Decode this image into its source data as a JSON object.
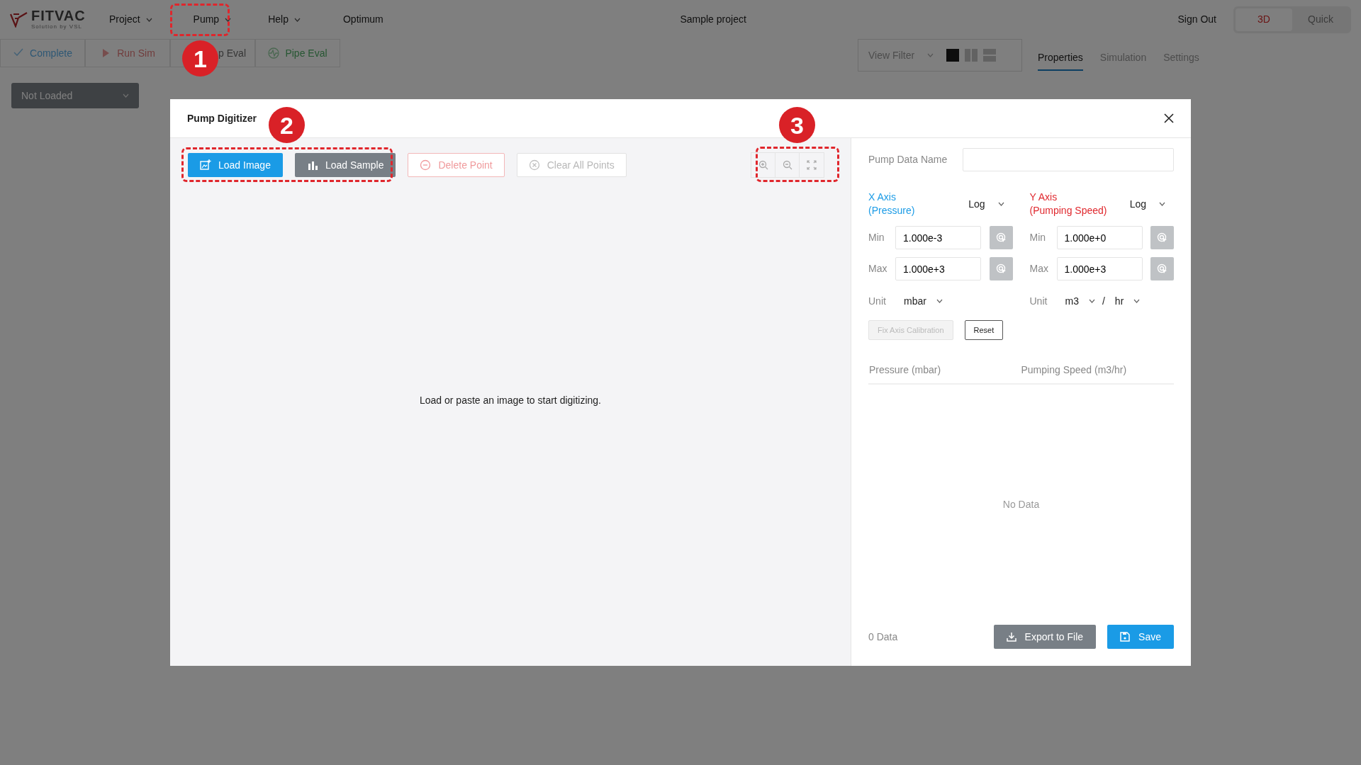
{
  "app": {
    "logo_text": "FITVAC",
    "logo_tagline": "Solution by VSL"
  },
  "menu": [
    {
      "label": "Project",
      "dropdown": true
    },
    {
      "label": "Pump",
      "dropdown": true
    },
    {
      "label": "Help",
      "dropdown": true
    },
    {
      "label": "Optimum",
      "dropdown": false
    }
  ],
  "project_title": "Sample project",
  "sign_out": "Sign Out",
  "mode_toggle": [
    {
      "label": "3D",
      "selected": true
    },
    {
      "label": "Quick",
      "selected": false
    }
  ],
  "toolbar": [
    {
      "label": "Complete",
      "kind": "check"
    },
    {
      "label": "Run Sim",
      "kind": "play"
    },
    {
      "label": "p Eval",
      "kind": "plain"
    },
    {
      "label": "Pipe Eval",
      "kind": "pulse"
    }
  ],
  "view_filter": {
    "label": "View Filter"
  },
  "layouts": [
    {
      "kind": "single",
      "selected": true
    },
    {
      "kind": "columns",
      "selected": false
    },
    {
      "kind": "rows",
      "selected": false
    }
  ],
  "panel_tabs": [
    {
      "label": "Properties",
      "selected": true
    },
    {
      "label": "Simulation",
      "selected": false
    },
    {
      "label": "Settings",
      "selected": false
    }
  ],
  "model_select": {
    "value": "Not Loaded"
  },
  "modal": {
    "title": "Pump Digitizer",
    "actions": [
      {
        "label": "Load Image",
        "kind": "primary"
      },
      {
        "label": "Load Sample",
        "kind": "secondary"
      },
      {
        "label": "Delete Point",
        "kind": "danger"
      },
      {
        "label": "Clear All Points",
        "kind": "disabled"
      }
    ],
    "zoom_tools": [
      {
        "kind": "zoom-in"
      },
      {
        "kind": "zoom-out"
      },
      {
        "kind": "fit"
      }
    ],
    "canvas_message": "Load or paste an image to start digitizing.",
    "name_label": "Pump Data Name",
    "axes": [
      {
        "title": "X Axis",
        "subtitle": "(Pressure)",
        "color": "#1a9be6",
        "scale": "Log",
        "min_label": "Min",
        "min": "1.000e-3",
        "max_label": "Max",
        "max": "1.000e+3",
        "unit_label": "Unit",
        "units": [
          "mbar"
        ]
      },
      {
        "title": "Y Axis",
        "subtitle": "(Pumping Speed)",
        "color": "#e0282e",
        "scale": "Log",
        "min_label": "Min",
        "min": "1.000e+0",
        "max_label": "Max",
        "max": "1.000e+3",
        "unit_label": "Unit",
        "units": [
          "m3",
          "hr"
        ],
        "unit_separator": "/"
      }
    ],
    "calibration_buttons": [
      {
        "label": "Fix Axis Calibration",
        "disabled": true
      },
      {
        "label": "Reset",
        "disabled": false
      }
    ],
    "table": {
      "columns": [
        "Pressure (mbar)",
        "Pumping Speed (m3/hr)"
      ],
      "empty_text": "No Data"
    },
    "count": "0 Data",
    "export_button": "Export to File",
    "save_button": "Save"
  },
  "annotations": [
    {
      "number": "1"
    },
    {
      "number": "2"
    },
    {
      "number": "3"
    }
  ]
}
